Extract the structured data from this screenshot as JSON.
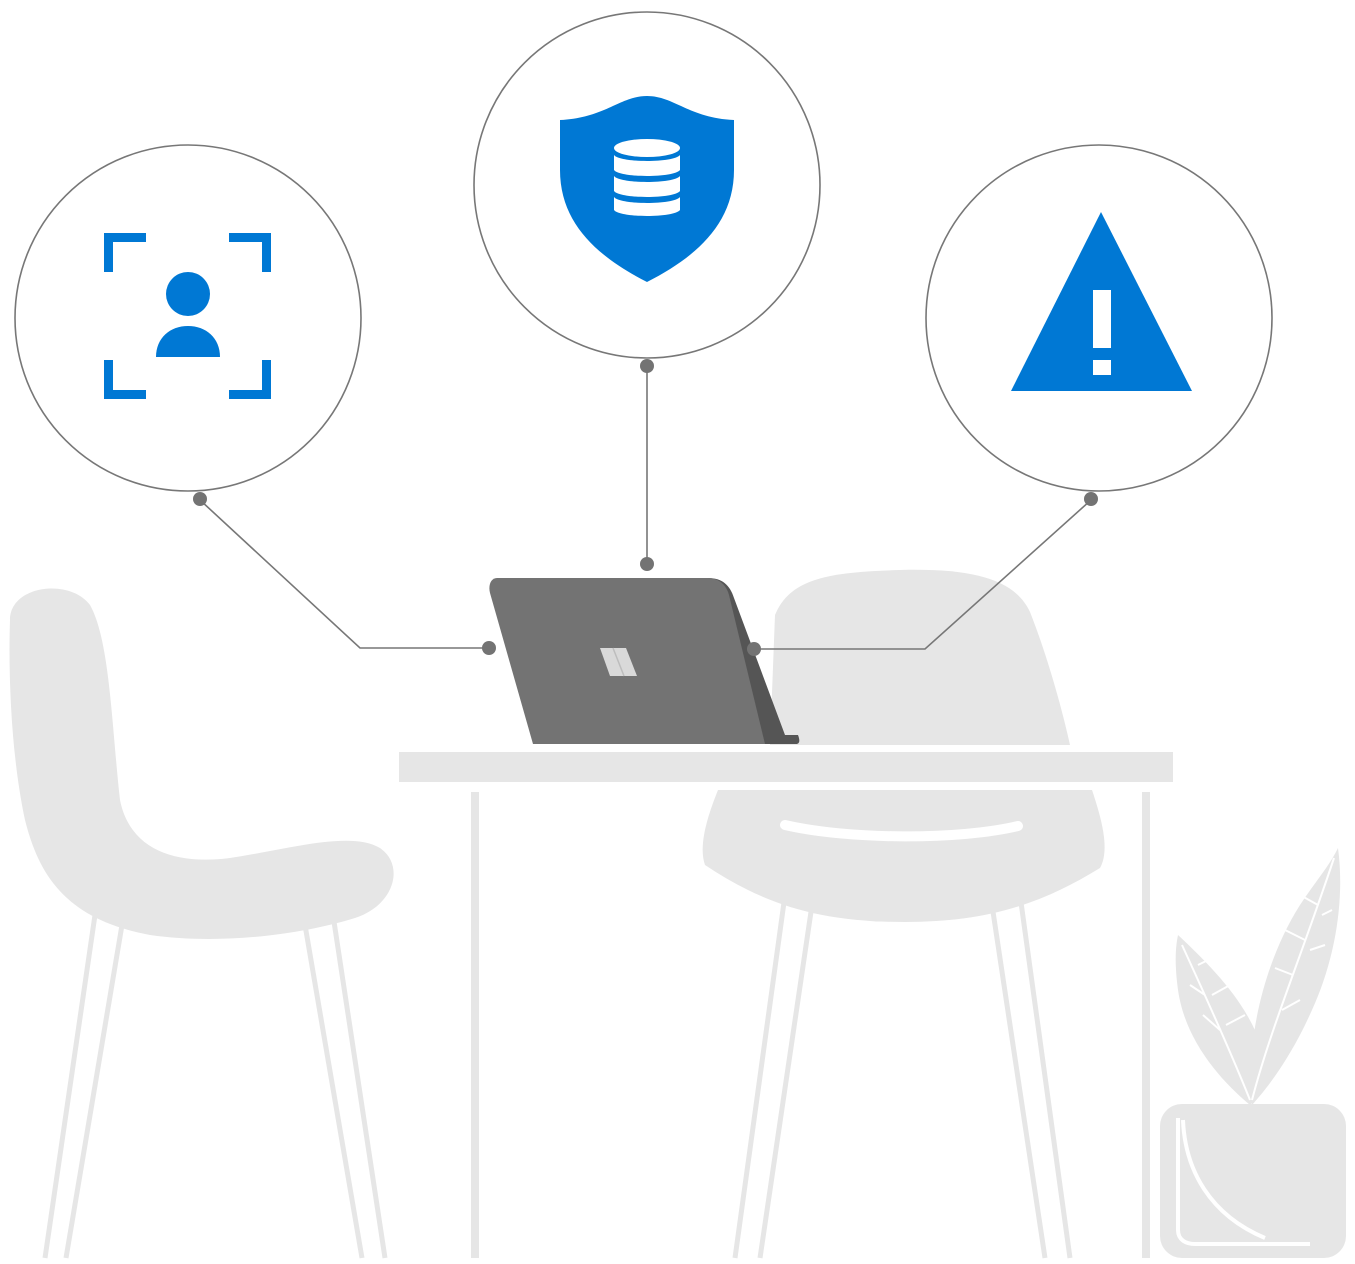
{
  "colors": {
    "accent": "#0078d4",
    "connector": "#777777",
    "laptop": "#737373",
    "laptop_dark": "#555555",
    "furniture": "#e6e6e6"
  },
  "icons": [
    {
      "name": "user-identity-scan-icon",
      "position": "left"
    },
    {
      "name": "database-shield-icon",
      "position": "top-center"
    },
    {
      "name": "warning-triangle-icon",
      "position": "right"
    }
  ],
  "scene": {
    "objects": [
      "laptop",
      "table",
      "chair-left",
      "chair-right",
      "plant-in-pot"
    ]
  }
}
